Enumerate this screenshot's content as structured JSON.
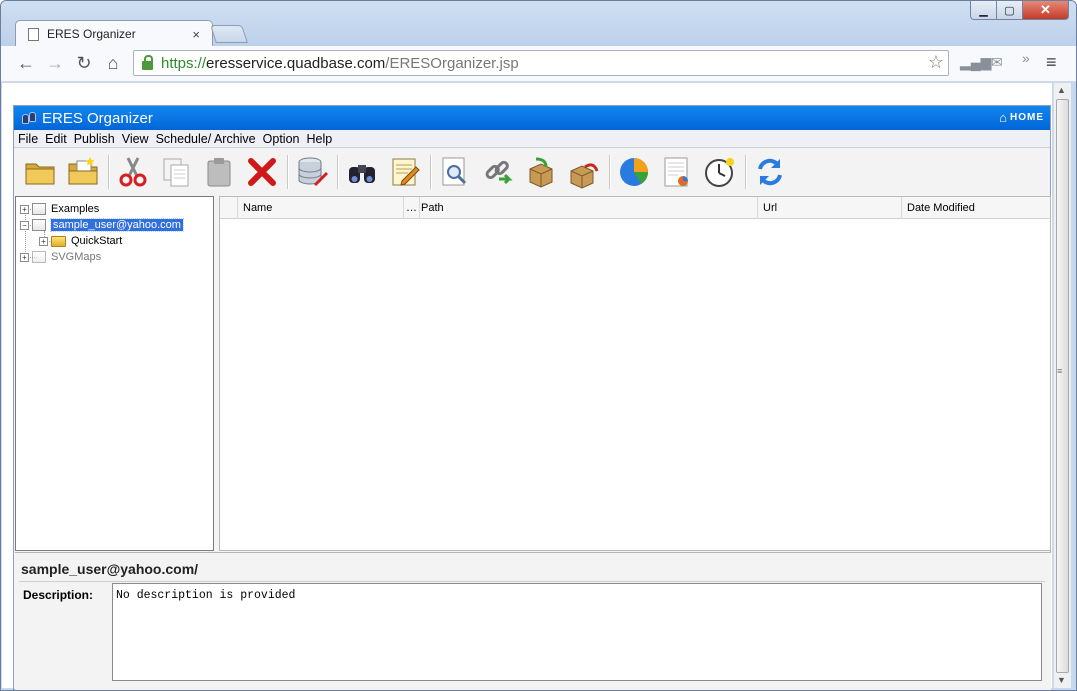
{
  "browser": {
    "tab_title": "ERES Organizer",
    "tab_close": "×",
    "url_scheme": "https://",
    "url_host": "eresservice.quadbase.com",
    "url_path": "/ERESOrganizer.jsp",
    "nav": {
      "back": "←",
      "forward": "→",
      "reload": "↻",
      "home": "⌂"
    },
    "star": "☆",
    "more": "»",
    "menu": "≡"
  },
  "app": {
    "title": "ERES Organizer",
    "home_label": "HOME",
    "menu": [
      "File",
      "Edit",
      "Publish",
      "View",
      "Schedule/ Archive",
      "Option",
      "Help"
    ],
    "toolbar_icons": [
      "new-folder-icon",
      "open-folder-icon",
      "cut-icon",
      "copy-icon",
      "paste-icon",
      "delete-icon",
      "database-icon",
      "find-icon",
      "notes-icon",
      "preview-icon",
      "link-icon",
      "import-icon",
      "export-icon",
      "pie-chart-icon",
      "report-icon",
      "schedule-icon",
      "refresh-icon"
    ],
    "tree": {
      "nodes": [
        {
          "label": "Examples",
          "expander": "+"
        },
        {
          "label": "sample_user@yahoo.com",
          "expander": "−",
          "selected": true
        },
        {
          "label": "QuickStart",
          "expander": "+"
        },
        {
          "label": "SVGMaps",
          "expander": "+"
        }
      ]
    },
    "list": {
      "columns": [
        "",
        "Name",
        "…",
        "Path",
        "Url",
        "Date Modified"
      ],
      "rows": []
    },
    "details": {
      "path": "sample_user@yahoo.com/",
      "description_label": "Description:",
      "description_text": "No description is provided"
    }
  },
  "colors": {
    "app_bar": "#0a74e6",
    "selection": "#2f6fde",
    "url_green": "#2f8a2f"
  }
}
